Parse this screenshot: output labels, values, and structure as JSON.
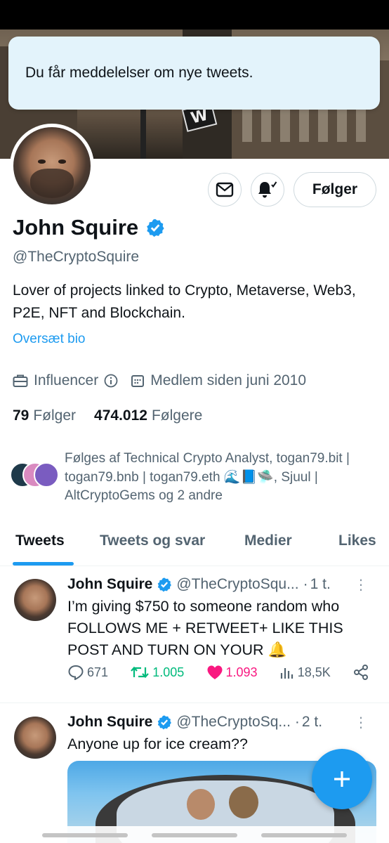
{
  "toast": {
    "message": "Du får meddelelser om nye tweets."
  },
  "profile": {
    "name": "John Squire",
    "handle": "@TheCryptoSquire",
    "bio": "Lover of projects linked to Crypto, Metaverse, Web3, P2E, NFT and Blockchain.",
    "translate_label": "Oversæt bio",
    "category": "Influencer",
    "joined": "Medlem siden juni 2010",
    "following_count": "79",
    "following_label": "Følger",
    "followers_count": "474.012",
    "followers_label": "Følgere",
    "followed_by_line1": "Følges af Technical Crypto Analyst, togan79.bit |",
    "followed_by_line2": "togan79.bnb | togan79.eth 🌊📘🛸, Sjuul |",
    "followed_by_line3": "AltCryptoGems og 2 andre",
    "verified_color": "#1d9bf0"
  },
  "header_actions": {
    "follow_label": "Følger",
    "message_icon": "envelope-icon",
    "notify_icon": "bell-icon"
  },
  "banner": {
    "sign_text": "W"
  },
  "tabs": [
    {
      "label": "Tweets",
      "active": true
    },
    {
      "label": "Tweets og svar",
      "active": false
    },
    {
      "label": "Medier",
      "active": false
    },
    {
      "label": "Likes",
      "active": false
    }
  ],
  "tweets": [
    {
      "name": "John Squire",
      "handle": "@TheCryptoSqu...",
      "dot": "·",
      "time": "1 t.",
      "text": "I’m giving $750 to someone random who FOLLOWS ME + RETWEET+ LIKE THIS POST AND TURN ON YOUR 🔔",
      "replies": "671",
      "retweets": "1.005",
      "likes": "1.093",
      "views": "18,5K"
    },
    {
      "name": "John Squire",
      "handle": "@TheCryptoSq...",
      "dot": "·",
      "time": "2 t.",
      "text": "Anyone up for ice cream??"
    }
  ],
  "colors": {
    "accent": "#1d9bf0",
    "retweet": "#00ba7c",
    "like": "#f91880",
    "secondary_text": "#536471"
  }
}
